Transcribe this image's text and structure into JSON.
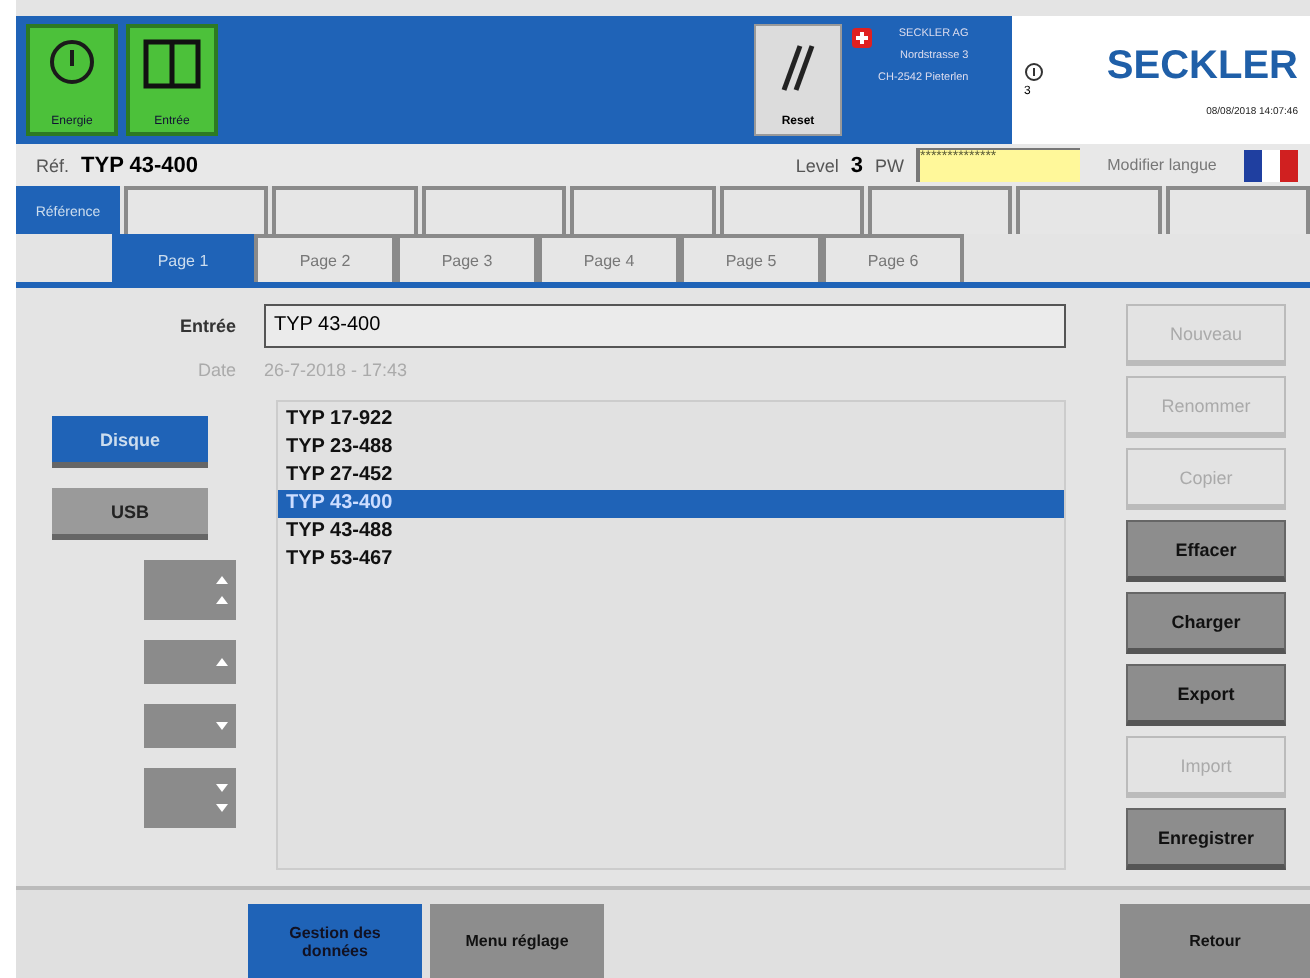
{
  "header": {
    "power_button": {
      "label": "Energie"
    },
    "split_button": {
      "label": "Entrée"
    },
    "reset_button": {
      "label": "Reset"
    },
    "address": [
      "SECKLER AG",
      "Nordstrasse 3",
      "CH-2542 Pieterlen"
    ],
    "info_number": "3",
    "logo": "SECKLER",
    "datetime": "08/08/2018 14:07:46"
  },
  "info_bar": {
    "ref_label": "Réf.",
    "ref_value": "TYP 43-400",
    "level_label": "Level",
    "level_value": "3",
    "pw_label": "PW",
    "pw_value": "**************",
    "lang_label": "Modifier langue"
  },
  "main_tabs": [
    {
      "label": "Référence",
      "selected": true
    },
    {
      "selected": false
    },
    {
      "selected": false
    },
    {
      "selected": false
    },
    {
      "selected": false
    },
    {
      "selected": false
    },
    {
      "selected": false
    },
    {
      "selected": false
    },
    {
      "selected": false
    }
  ],
  "page_tabs": [
    {
      "label": "Page 1",
      "selected": true
    },
    {
      "label": "Page 2",
      "selected": false
    },
    {
      "label": "Page 3",
      "selected": false
    },
    {
      "label": "Page 4",
      "selected": false
    },
    {
      "label": "Page 5",
      "selected": false
    },
    {
      "label": "Page 6",
      "selected": false
    }
  ],
  "entry": {
    "label": "Entrée",
    "value": "TYP 43-400"
  },
  "date": {
    "label": "Date",
    "value": "26-7-2018 - 17:43"
  },
  "storage_buttons": [
    {
      "label": "Disque",
      "selected": true
    },
    {
      "label": "USB",
      "selected": false
    }
  ],
  "scroll_buttons": [
    {
      "kind": "page-up"
    },
    {
      "kind": "up"
    },
    {
      "kind": "down"
    },
    {
      "kind": "page-down"
    }
  ],
  "files": [
    {
      "name": "TYP 17-922",
      "selected": false
    },
    {
      "name": "TYP 23-488",
      "selected": false
    },
    {
      "name": "TYP 27-452",
      "selected": false
    },
    {
      "name": "TYP 43-400",
      "selected": true
    },
    {
      "name": "TYP 43-488",
      "selected": false
    },
    {
      "name": "TYP 53-467",
      "selected": false
    }
  ],
  "actions": [
    {
      "label": "Nouveau",
      "disabled": true
    },
    {
      "label": "Renommer",
      "disabled": true
    },
    {
      "label": "Copier",
      "disabled": true
    },
    {
      "label": "Effacer",
      "disabled": false
    },
    {
      "label": "Charger",
      "disabled": false
    },
    {
      "label": "Export",
      "disabled": false
    },
    {
      "label": "Import",
      "disabled": true
    },
    {
      "label": "Enregistrer",
      "disabled": false
    }
  ],
  "bottom_nav": [
    {
      "label": "Gestion des données",
      "selected": true
    },
    {
      "label": "Menu réglage",
      "selected": false
    }
  ],
  "back_button": {
    "label": "Retour"
  }
}
